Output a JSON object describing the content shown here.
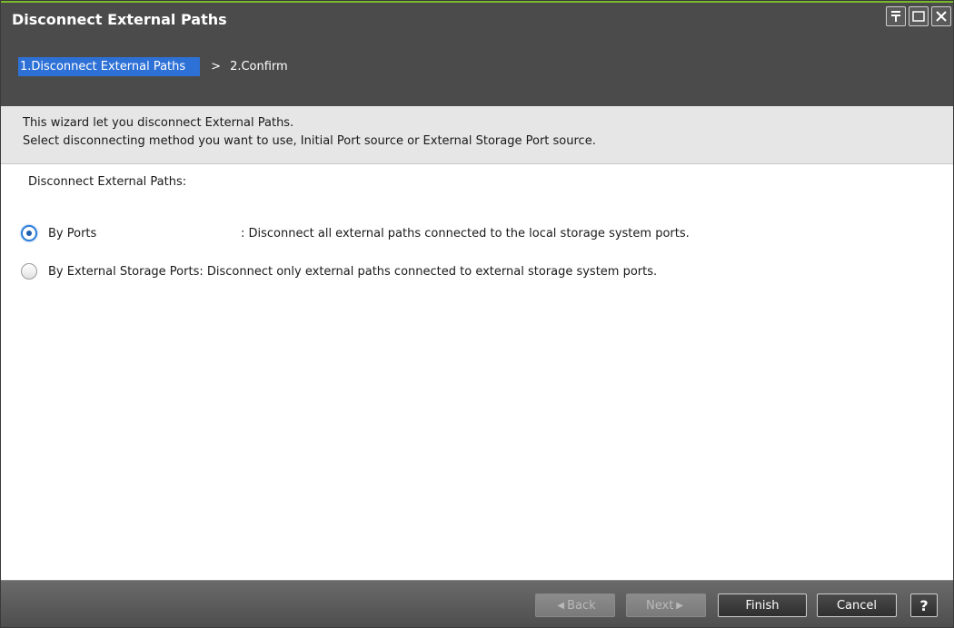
{
  "window": {
    "title": "Disconnect External Paths",
    "controls": [
      {
        "name": "pin-icon"
      },
      {
        "name": "maximize-icon"
      },
      {
        "name": "close-icon"
      }
    ]
  },
  "wizard": {
    "steps": [
      {
        "label": "1.Disconnect External Paths",
        "active": true
      },
      {
        "label": "2.Confirm",
        "active": false
      }
    ],
    "separator": ">"
  },
  "description": {
    "line1": "This wizard let you disconnect External Paths.",
    "line2": "Select disconnecting method you want to use, Initial Port source or External Storage Port source."
  },
  "main": {
    "section_label": "Disconnect External Paths:",
    "options": [
      {
        "label": "By Ports",
        "description": ": Disconnect all external paths connected to the local storage system ports.",
        "selected": true
      },
      {
        "label": "By External Storage Ports",
        "description": ": Disconnect only external paths connected to external storage system ports.",
        "selected": false
      }
    ]
  },
  "footer": {
    "back_label": "Back",
    "next_label": "Next",
    "finish_label": "Finish",
    "cancel_label": "Cancel",
    "help_label": "?"
  },
  "colors": {
    "title_accent": "#7bb82e",
    "active_step": "#2e71d6",
    "header_bg": "#4b4b4b",
    "description_bg": "#e6e6e6"
  }
}
